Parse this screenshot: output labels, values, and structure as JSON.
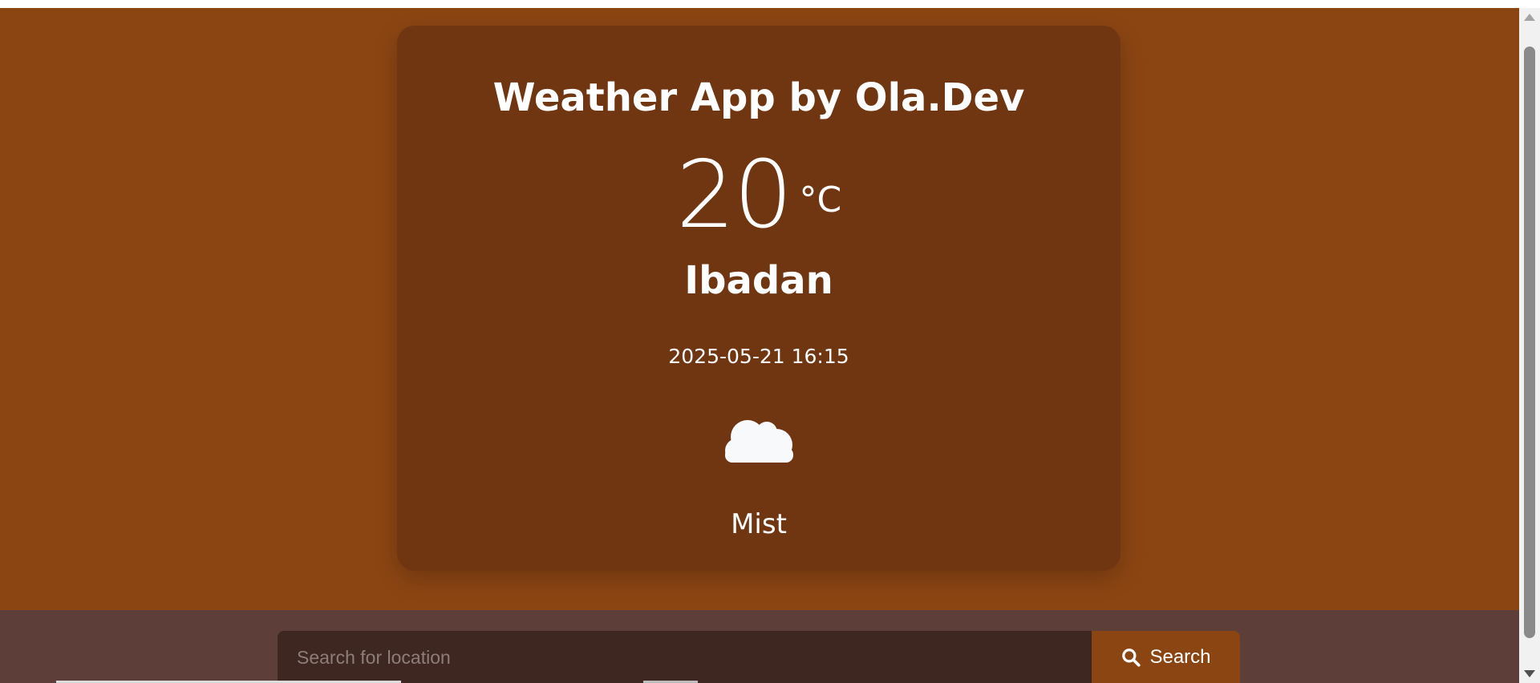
{
  "app": {
    "title": "Weather App by Ola.Dev"
  },
  "weather": {
    "temperature": "20",
    "unit": "°C",
    "city": "Ibadan",
    "datetime": "2025-05-21 16:15",
    "condition": "Mist",
    "icon": "cloud-icon"
  },
  "search": {
    "placeholder": "Search for location",
    "value": "",
    "button_label": "Search",
    "button_icon": "search-icon"
  },
  "colors": {
    "page_background": "#8B4513",
    "card_background": "#703612",
    "bottom_bar": "#5D3E38",
    "input_background": "#3E2621",
    "button_background": "#8B4513",
    "text": "#FFFFFF"
  }
}
